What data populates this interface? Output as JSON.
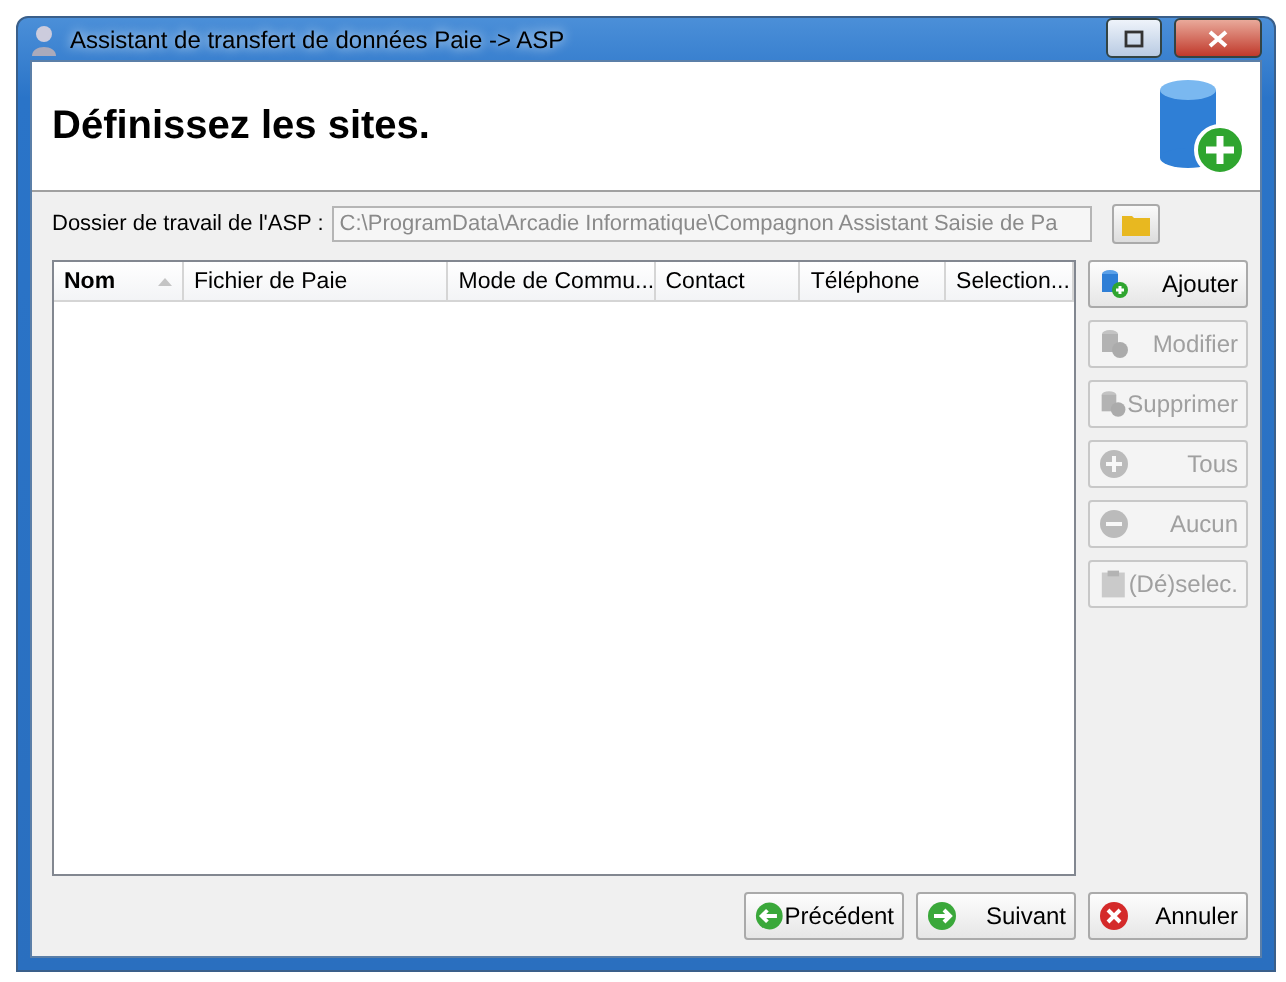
{
  "window": {
    "title": "Assistant de transfert de données Paie -> ASP"
  },
  "header": {
    "title": "Définissez les sites."
  },
  "folder": {
    "label": "Dossier de travail de l'ASP :",
    "value": "C:\\ProgramData\\Arcadie Informatique\\Compagnon Assistant Saisie de Pa",
    "disabled": true
  },
  "table": {
    "columns": [
      {
        "label": "Nom",
        "sorted": true
      },
      {
        "label": "Fichier de Paie",
        "sorted": false
      },
      {
        "label": "Mode de Commu...",
        "sorted": false
      },
      {
        "label": "Contact",
        "sorted": false
      },
      {
        "label": "Téléphone",
        "sorted": false
      },
      {
        "label": "Selection...",
        "sorted": false
      }
    ]
  },
  "side_buttons": [
    {
      "label": "Ajouter",
      "kind": "add",
      "disabled": false
    },
    {
      "label": "Modifier",
      "kind": "edit",
      "disabled": true
    },
    {
      "label": "Supprimer",
      "kind": "delete",
      "disabled": true
    },
    {
      "label": "Tous",
      "kind": "all",
      "disabled": true
    },
    {
      "label": "Aucun",
      "kind": "none",
      "disabled": true
    },
    {
      "label": "(Dé)selec.",
      "kind": "toggle",
      "disabled": true
    }
  ],
  "footer_buttons": [
    {
      "label": "Précédent",
      "kind": "back"
    },
    {
      "label": "Suivant",
      "kind": "next"
    },
    {
      "label": "Annuler",
      "kind": "cancel"
    }
  ]
}
